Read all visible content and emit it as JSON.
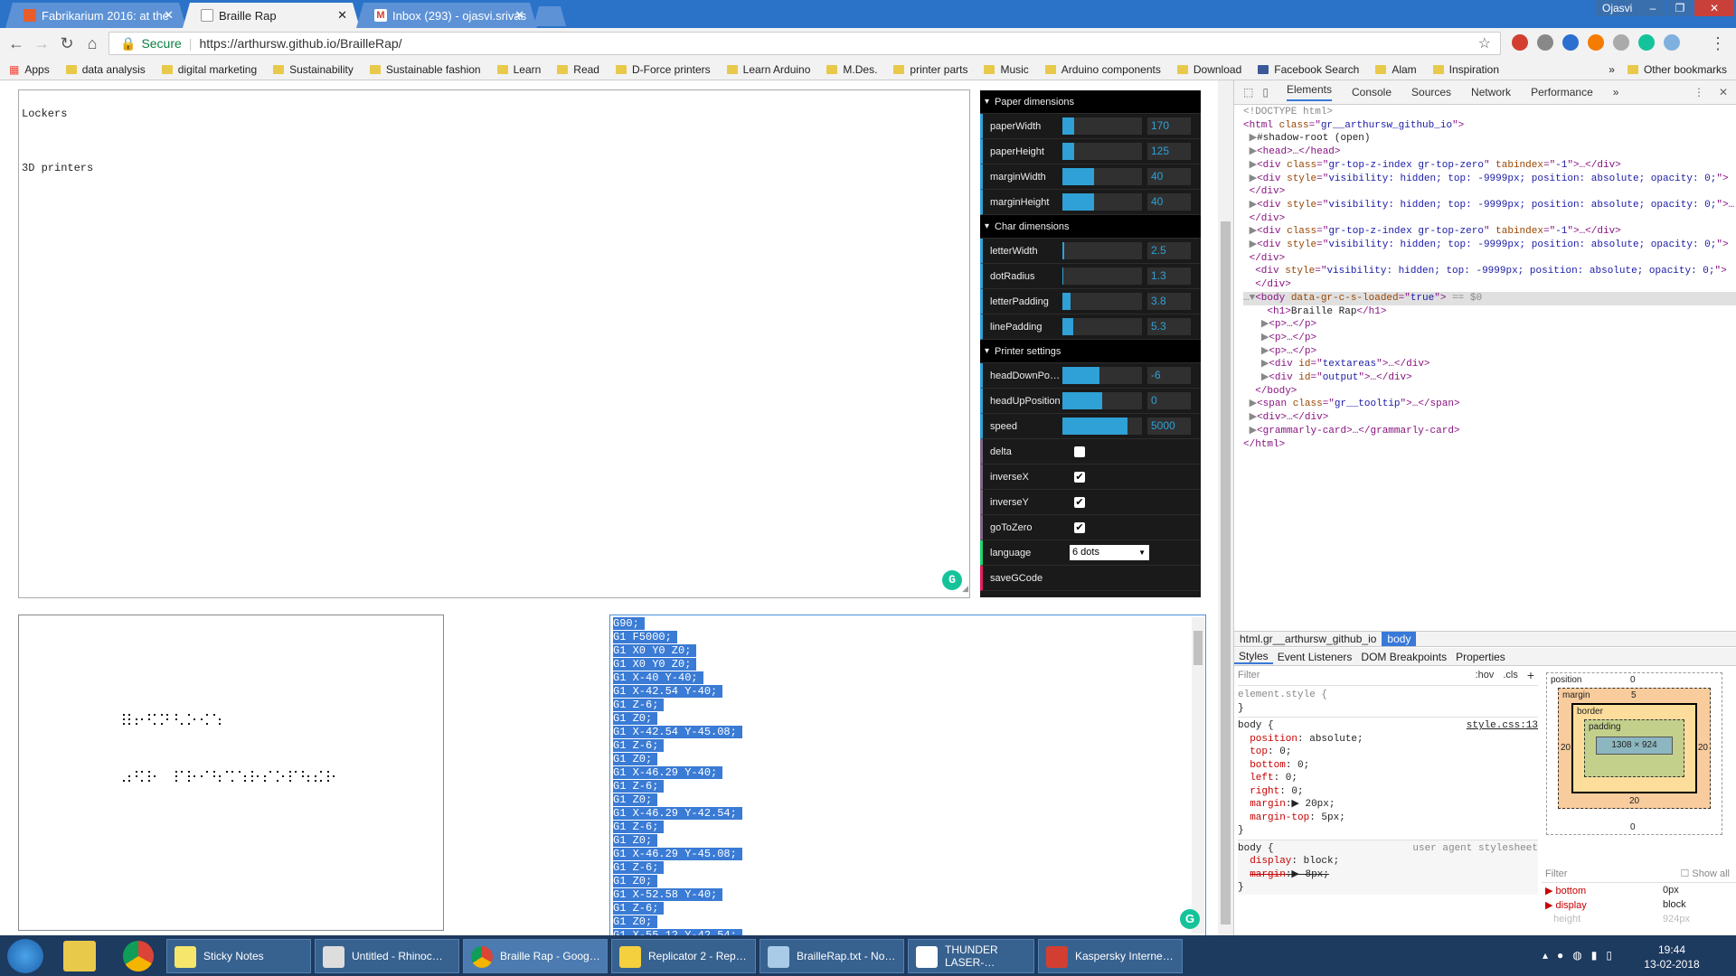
{
  "browser": {
    "tabs": [
      {
        "label": "Fabrikarium 2016: at the"
      },
      {
        "label": "Braille Rap"
      },
      {
        "label": "Inbox (293) - ojasvi.srivas"
      }
    ],
    "user": "Ojasvi",
    "secure_label": "Secure",
    "url": "https://arthursw.github.io/BrailleRap/",
    "bookmarks": [
      "Apps",
      "data analysis",
      "digital marketing",
      "Sustainability",
      "Sustainable fashion",
      "Learn",
      "Read",
      "D-Force printers",
      "Learn Arduino",
      "M.Des.",
      "printer parts",
      "Music",
      "Arduino components",
      "Download",
      "Facebook Search",
      "Alam",
      "Inspiration"
    ],
    "other_bookmarks": "Other bookmarks"
  },
  "page": {
    "text_lines": [
      "Lockers",
      "",
      "3D printers"
    ],
    "gui": {
      "folders": [
        {
          "title": "Paper dimensions",
          "rows": [
            {
              "label": "paperWidth",
              "value": "170",
              "fill": 0.15
            },
            {
              "label": "paperHeight",
              "value": "125",
              "fill": 0.15
            },
            {
              "label": "marginWidth",
              "value": "40",
              "fill": 0.4
            },
            {
              "label": "marginHeight",
              "value": "40",
              "fill": 0.4
            }
          ]
        },
        {
          "title": "Char dimensions",
          "rows": [
            {
              "label": "letterWidth",
              "value": "2.5",
              "fill": 0.02
            },
            {
              "label": "dotRadius",
              "value": "1.3",
              "fill": 0.01
            },
            {
              "label": "letterPadding",
              "value": "3.8",
              "fill": 0.1
            },
            {
              "label": "linePadding",
              "value": "5.3",
              "fill": 0.14
            }
          ]
        },
        {
          "title": "Printer settings",
          "rows": [
            {
              "label": "headDownPositi…",
              "value": "-6",
              "fill": 0.47
            },
            {
              "label": "headUpPosition",
              "value": "0",
              "fill": 0.5
            },
            {
              "label": "speed",
              "value": "5000",
              "fill": 0.82
            }
          ]
        }
      ],
      "checks": [
        {
          "label": "delta",
          "checked": false
        },
        {
          "label": "inverseX",
          "checked": true
        },
        {
          "label": "inverseY",
          "checked": true
        },
        {
          "label": "goToZero",
          "checked": true
        }
      ],
      "language_label": "language",
      "language_value": "6 dots",
      "save_label": "saveGCode"
    },
    "gcode": [
      "G90;",
      "G1 F5000;",
      "G1 X0 Y0 Z0;",
      "G1 X0 Y0 Z0;",
      "G1 X-40 Y-40;",
      "G1 X-42.54 Y-40;",
      "G1 Z-6;",
      "G1 Z0;",
      "G1 X-42.54 Y-45.08;",
      "G1 Z-6;",
      "G1 Z0;",
      "G1 X-46.29 Y-40;",
      "G1 Z-6;",
      "G1 Z0;",
      "G1 X-46.29 Y-42.54;",
      "G1 Z-6;",
      "G1 Z0;",
      "G1 X-46.29 Y-45.08;",
      "G1 Z-6;",
      "G1 Z0;",
      "G1 X-52.58 Y-40;",
      "G1 Z-6;",
      "G1 Z0;",
      "G1 X-55.12 Y-42.54;"
    ]
  },
  "devtools": {
    "tabs": [
      "Elements",
      "Console",
      "Sources",
      "Network",
      "Performance"
    ],
    "crumbs": [
      "html.gr__arthursw_github_io",
      "body"
    ],
    "style_tabs": [
      "Styles",
      "Event Listeners",
      "DOM Breakpoints",
      "Properties"
    ],
    "filter": "Filter",
    "hov": ":hov",
    "cls": ".cls",
    "style_source": "style.css:13",
    "ua_label": "user agent stylesheet",
    "box": {
      "position": "position",
      "pos_val": "0",
      "margin": "margin",
      "margin_top": "5",
      "border": "border",
      "padding": "padding",
      "content": "1308 × 924",
      "left": "20",
      "right": "20",
      "bottom": "20",
      "dash": "–",
      "outer_bottom": "0"
    },
    "computed_filter": "Filter",
    "show_all": "Show all",
    "computed": [
      {
        "name": "bottom",
        "value": "0px"
      },
      {
        "name": "display",
        "value": "block"
      },
      {
        "name": "height",
        "value": "924px"
      }
    ]
  },
  "taskbar": {
    "items": [
      "Sticky Notes",
      "Untitled - Rhinoc…",
      "Braille Rap - Goog…",
      "Replicator 2 - Rep…",
      "BrailleRap.txt - No…",
      "THUNDER LASER-…",
      "Kaspersky Interne…"
    ],
    "time": "19:44",
    "date": "13-02-2018"
  }
}
